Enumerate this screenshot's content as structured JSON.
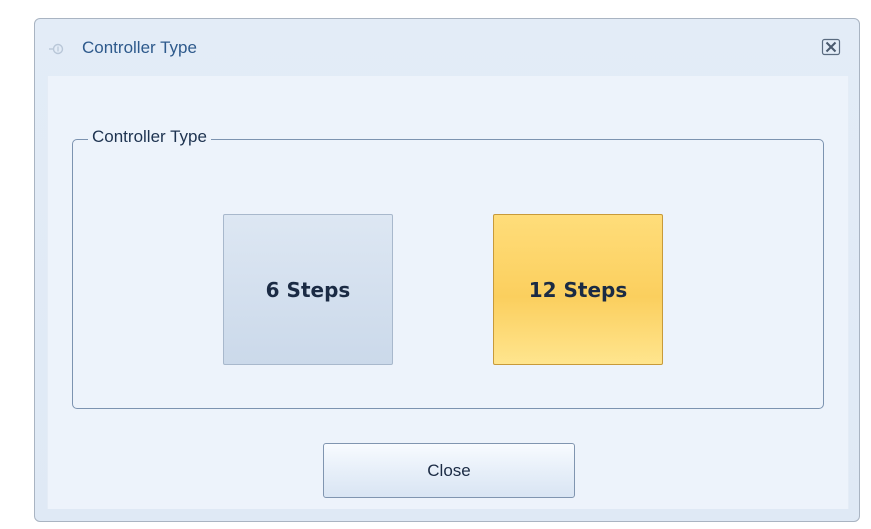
{
  "window": {
    "title": "Controller Type",
    "title_icon": "controller-icon",
    "close_icon": "close-icon"
  },
  "group": {
    "label": "Controller Type",
    "options": [
      {
        "label": "6 Steps",
        "selected": false
      },
      {
        "label": "12 Steps",
        "selected": true
      }
    ]
  },
  "footer": {
    "close_label": "Close"
  },
  "colors": {
    "title_text": "#2e5a8c",
    "selected_tile": "#fbcf5e",
    "unselected_tile": "#cbd9ea",
    "client_bg": "#edf3fb"
  }
}
